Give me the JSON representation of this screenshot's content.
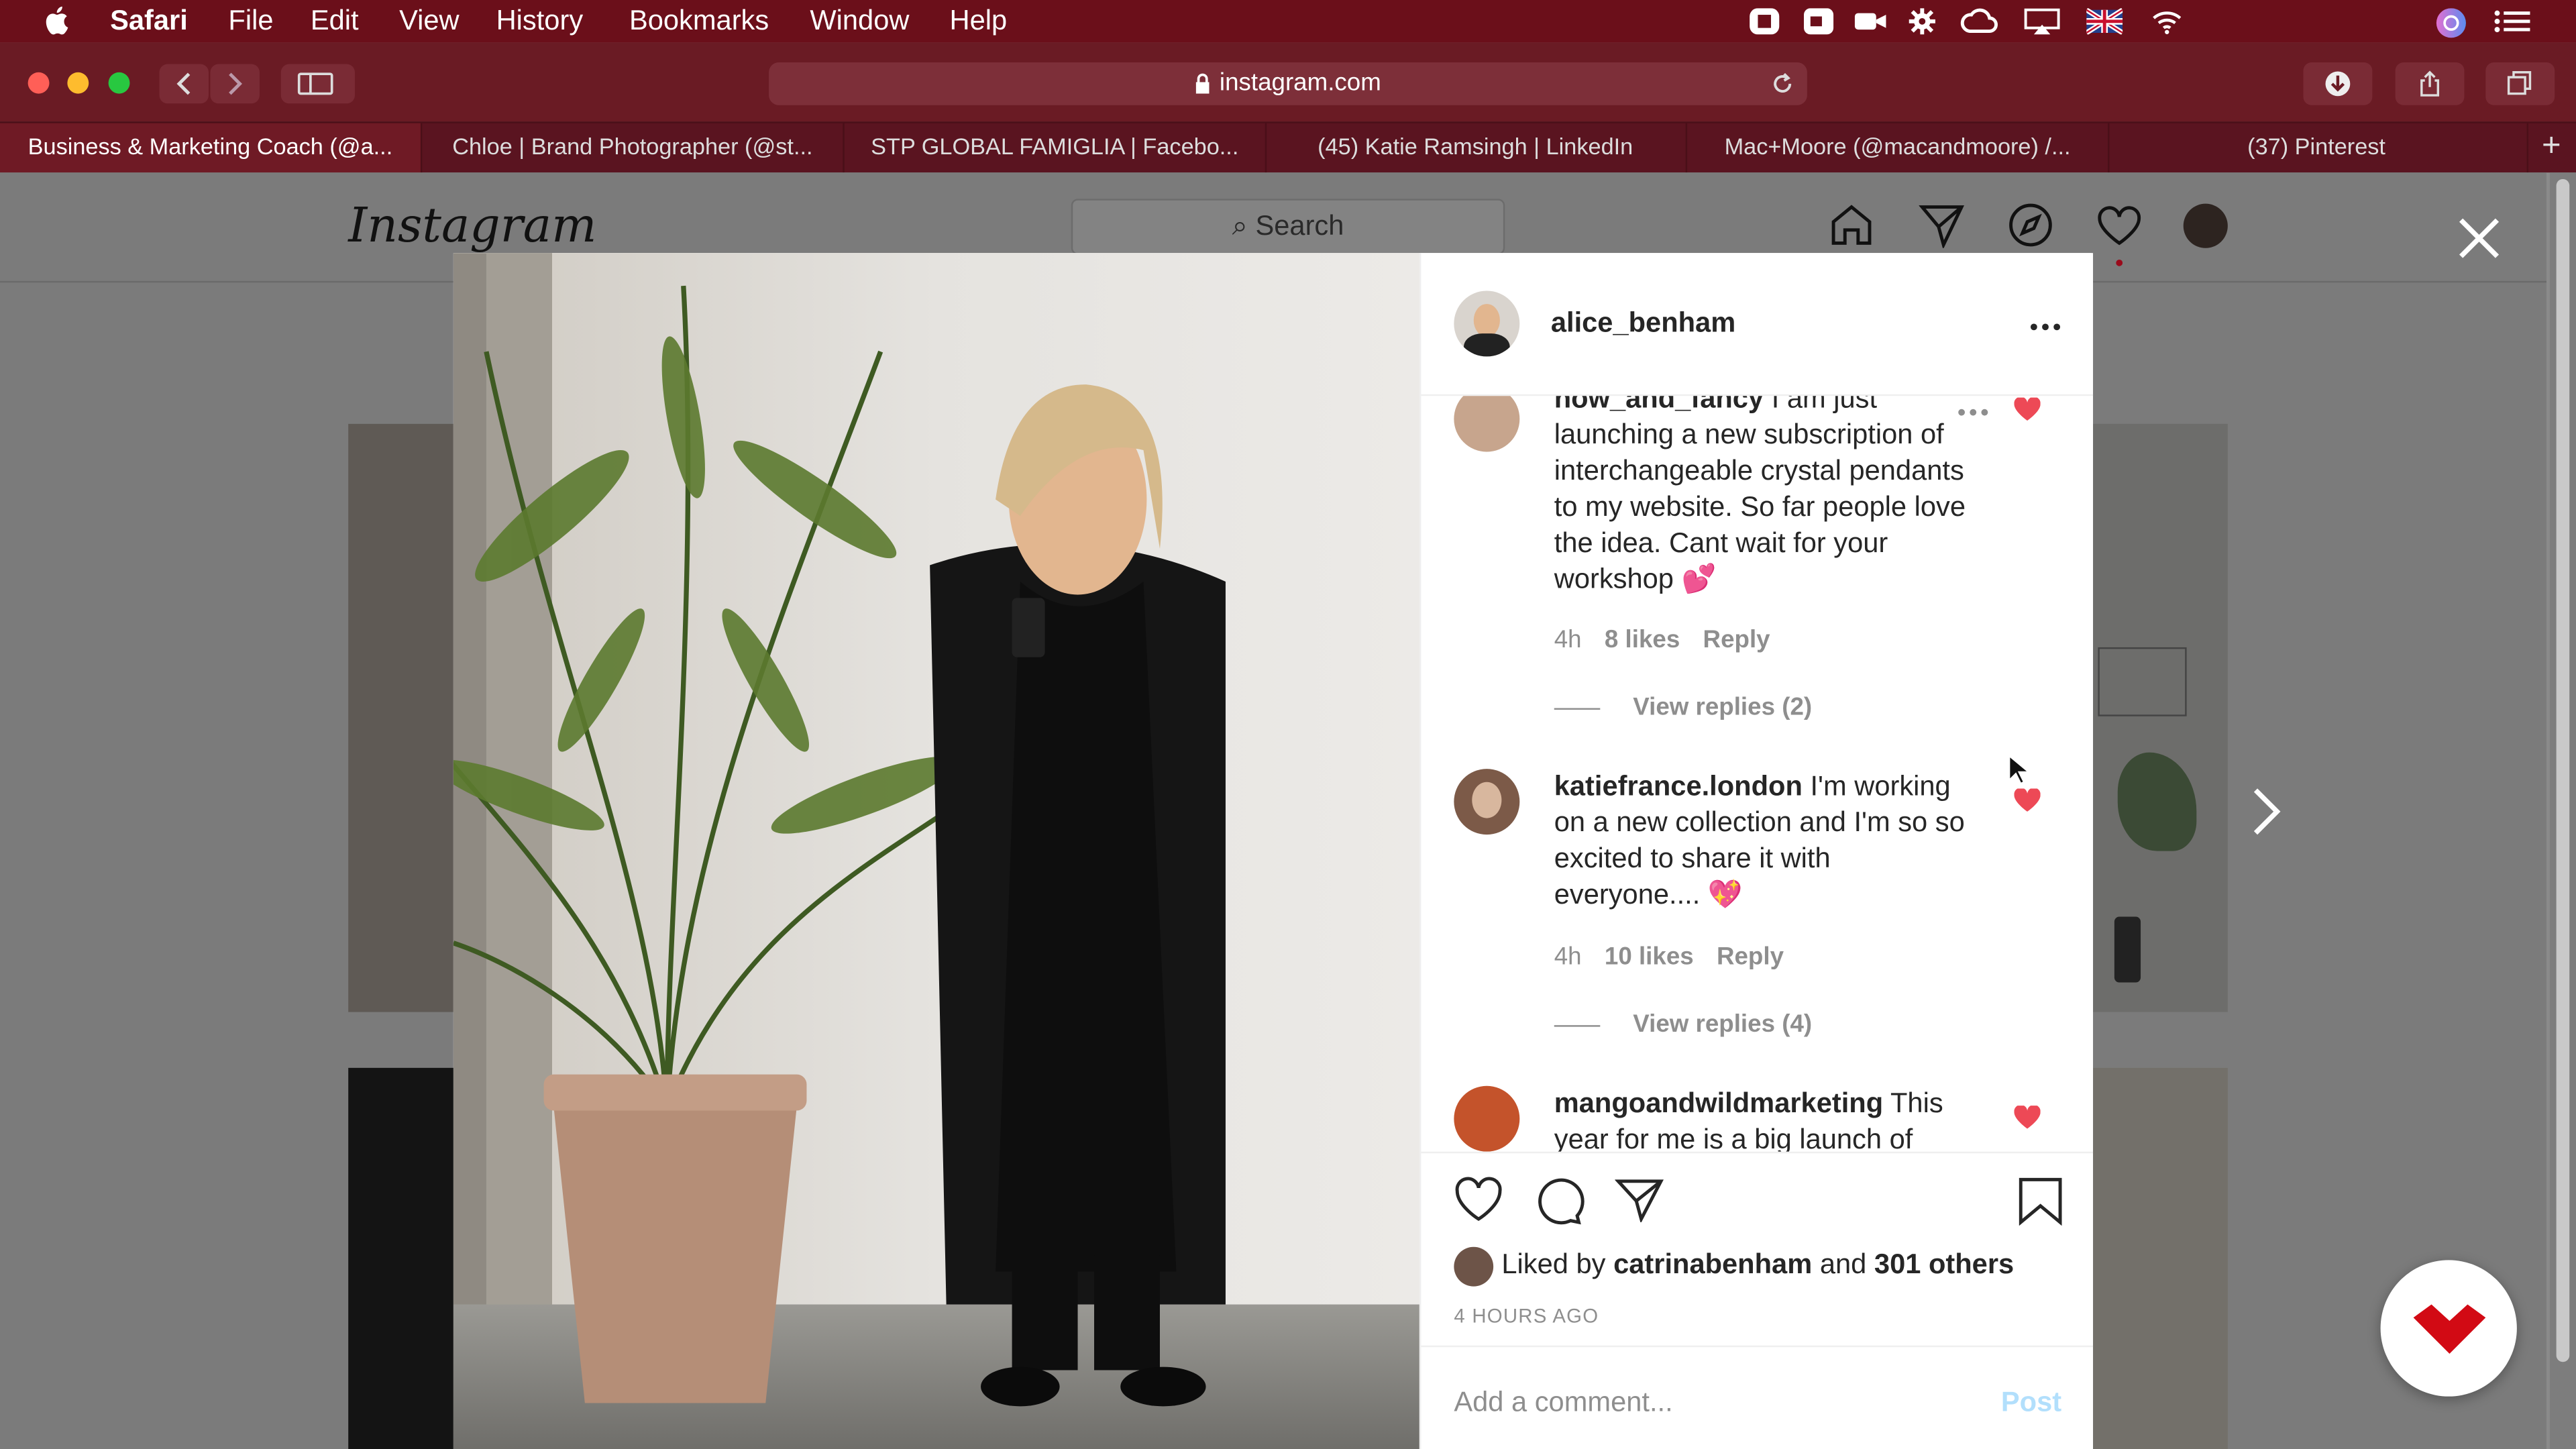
{
  "menubar": {
    "app": "Safari",
    "items": [
      "File",
      "Edit",
      "View",
      "History",
      "Bookmarks",
      "Window",
      "Help"
    ]
  },
  "toolbar": {
    "url": "instagram.com"
  },
  "tabs": [
    {
      "label": "Business & Marketing Coach (@a...",
      "active": true
    },
    {
      "label": "Chloe | Brand Photographer (@st...",
      "active": false
    },
    {
      "label": "STP GLOBAL FAMIGLIA | Facebo...",
      "active": false
    },
    {
      "label": "(45) Katie Ramsingh | LinkedIn",
      "active": false
    },
    {
      "label": "Mac+Moore (@macandmoore) /...",
      "active": false
    },
    {
      "label": "(37) Pinterest",
      "active": false
    }
  ],
  "instagram": {
    "logo": "Instagram",
    "search_placeholder": "Search"
  },
  "post": {
    "username": "alice_benham",
    "comments": [
      {
        "user": "now_and_fancy",
        "text": "I am just launching a new subscription of interchangeable crystal pendants to my website. So far people love the idea. Cant wait for your workshop 💕",
        "time": "4h",
        "likes": "8 likes",
        "reply": "Reply",
        "view_replies": "View replies (2)"
      },
      {
        "user": "katiefrance.london",
        "text": "I'm working on a new collection and I'm so so excited to share it with everyone.... 💖",
        "time": "4h",
        "likes": "10 likes",
        "reply": "Reply",
        "view_replies": "View replies (4)"
      },
      {
        "user": "mangoandwildmarketing",
        "text": "This year for me is a big launch of"
      }
    ],
    "liked_by_prefix": "Liked by",
    "liked_by_user": "catrinabenham",
    "liked_by_and": "and",
    "liked_by_others": "301 others",
    "timestamp": "4 HOURS AGO",
    "comment_placeholder": "Add a comment...",
    "post_button": "Post"
  },
  "colors": {
    "menubar": "#6b0f1a",
    "heart_red": "#ed4956",
    "post_button": "#b2dffc"
  }
}
